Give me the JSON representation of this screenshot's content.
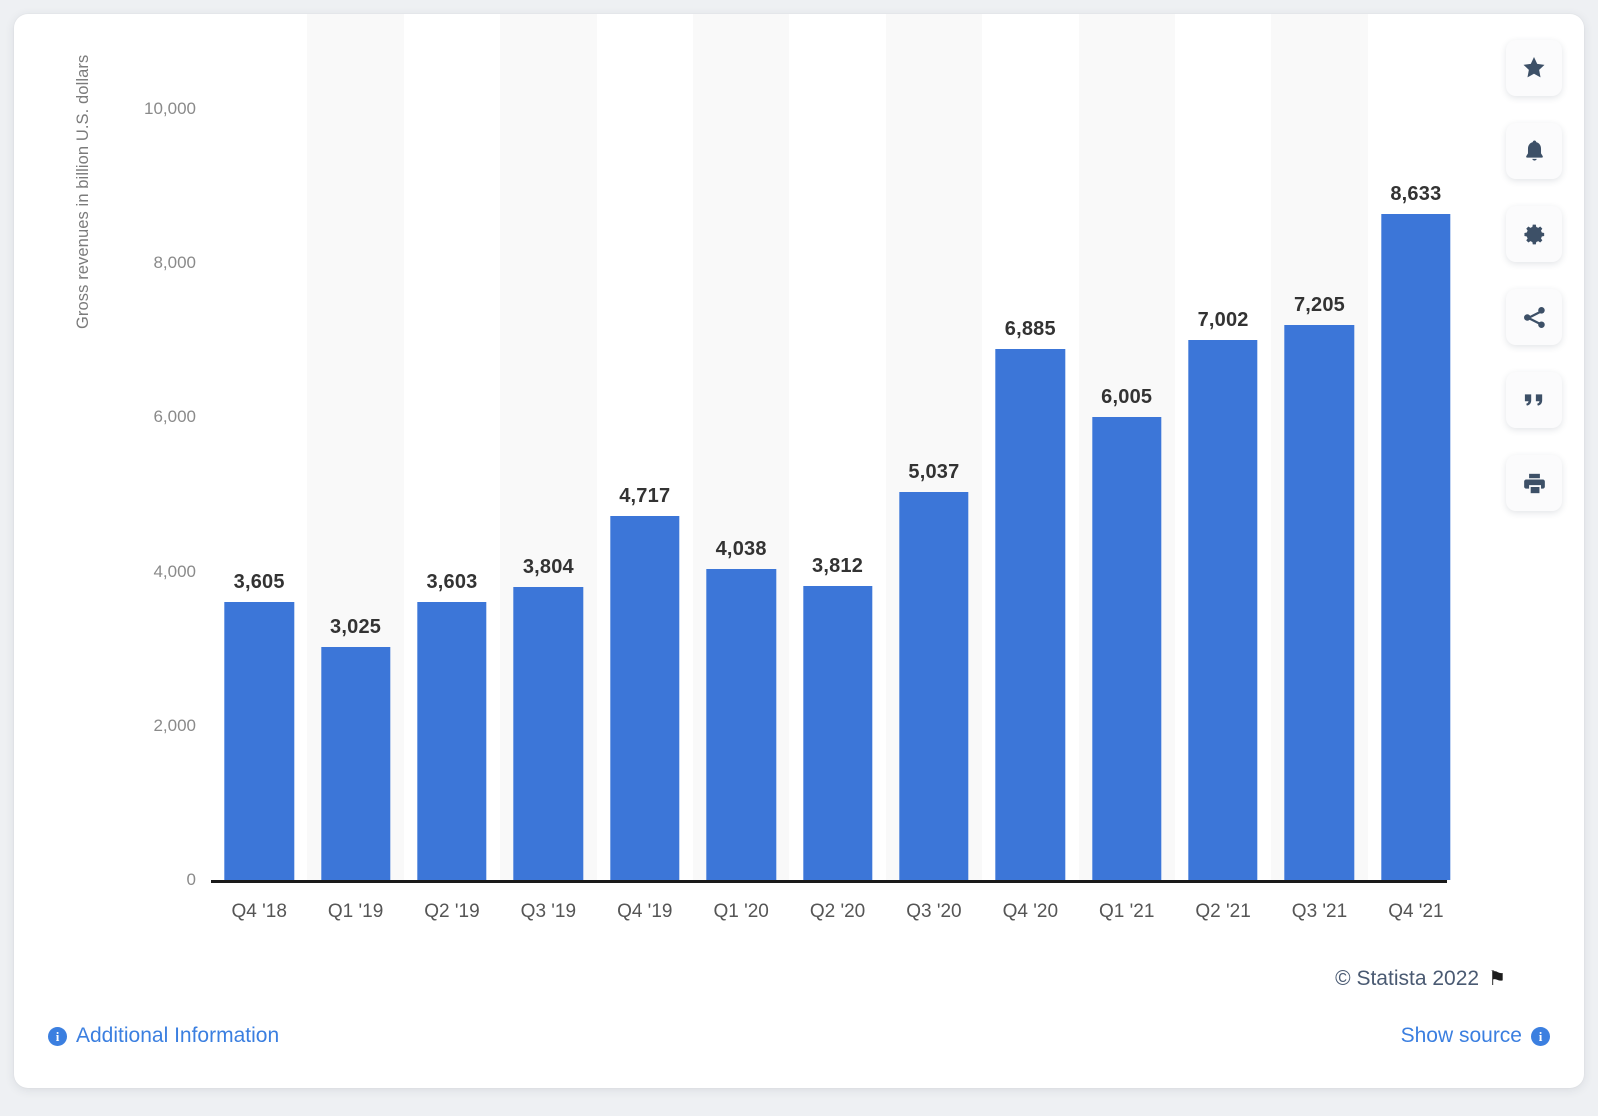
{
  "chart_data": {
    "type": "bar",
    "title": "",
    "subtitle": "",
    "xlabel": "",
    "ylabel": "Gross revenues in billion U.S. dollars",
    "categories": [
      "Q4 '18",
      "Q1 '19",
      "Q2 '19",
      "Q3 '19",
      "Q4 '19",
      "Q1 '20",
      "Q2 '20",
      "Q3 '20",
      "Q4 '20",
      "Q1 '21",
      "Q2 '21",
      "Q3 '21",
      "Q4 '21"
    ],
    "values": [
      3605,
      3025,
      3603,
      3804,
      4717,
      4038,
      3812,
      5037,
      6885,
      6005,
      7002,
      7205,
      8633
    ],
    "value_labels": [
      "3,605",
      "3,025",
      "3,603",
      "3,804",
      "4,717",
      "4,038",
      "3,812",
      "5,037",
      "6,885",
      "6,005",
      "7,002",
      "7,205",
      "8,633"
    ],
    "ylim": [
      0,
      10000
    ],
    "y_ticks": [
      0,
      2000,
      4000,
      6000,
      8000,
      10000
    ],
    "y_tick_labels": [
      "0",
      "2,000",
      "4,000",
      "6,000",
      "8,000",
      "10,000"
    ],
    "grid": true,
    "legend": null,
    "series_color": "#3c76d8",
    "bar_label_color": "#333333"
  },
  "toolbar": {
    "items": [
      {
        "name": "favorite-button",
        "icon": "star-icon",
        "label": "Favorite"
      },
      {
        "name": "alert-button",
        "icon": "bell-icon",
        "label": "Alert"
      },
      {
        "name": "settings-button",
        "icon": "gear-icon",
        "label": "Settings"
      },
      {
        "name": "share-button",
        "icon": "share-icon",
        "label": "Share"
      },
      {
        "name": "citation-button",
        "icon": "quote-icon",
        "label": "Citation"
      },
      {
        "name": "print-button",
        "icon": "print-icon",
        "label": "Print"
      }
    ]
  },
  "footer": {
    "copyright": "© Statista 2022",
    "flag_glyph": "⚑",
    "additional_information": "Additional Information",
    "show_source": "Show source",
    "info_glyph": "i"
  }
}
